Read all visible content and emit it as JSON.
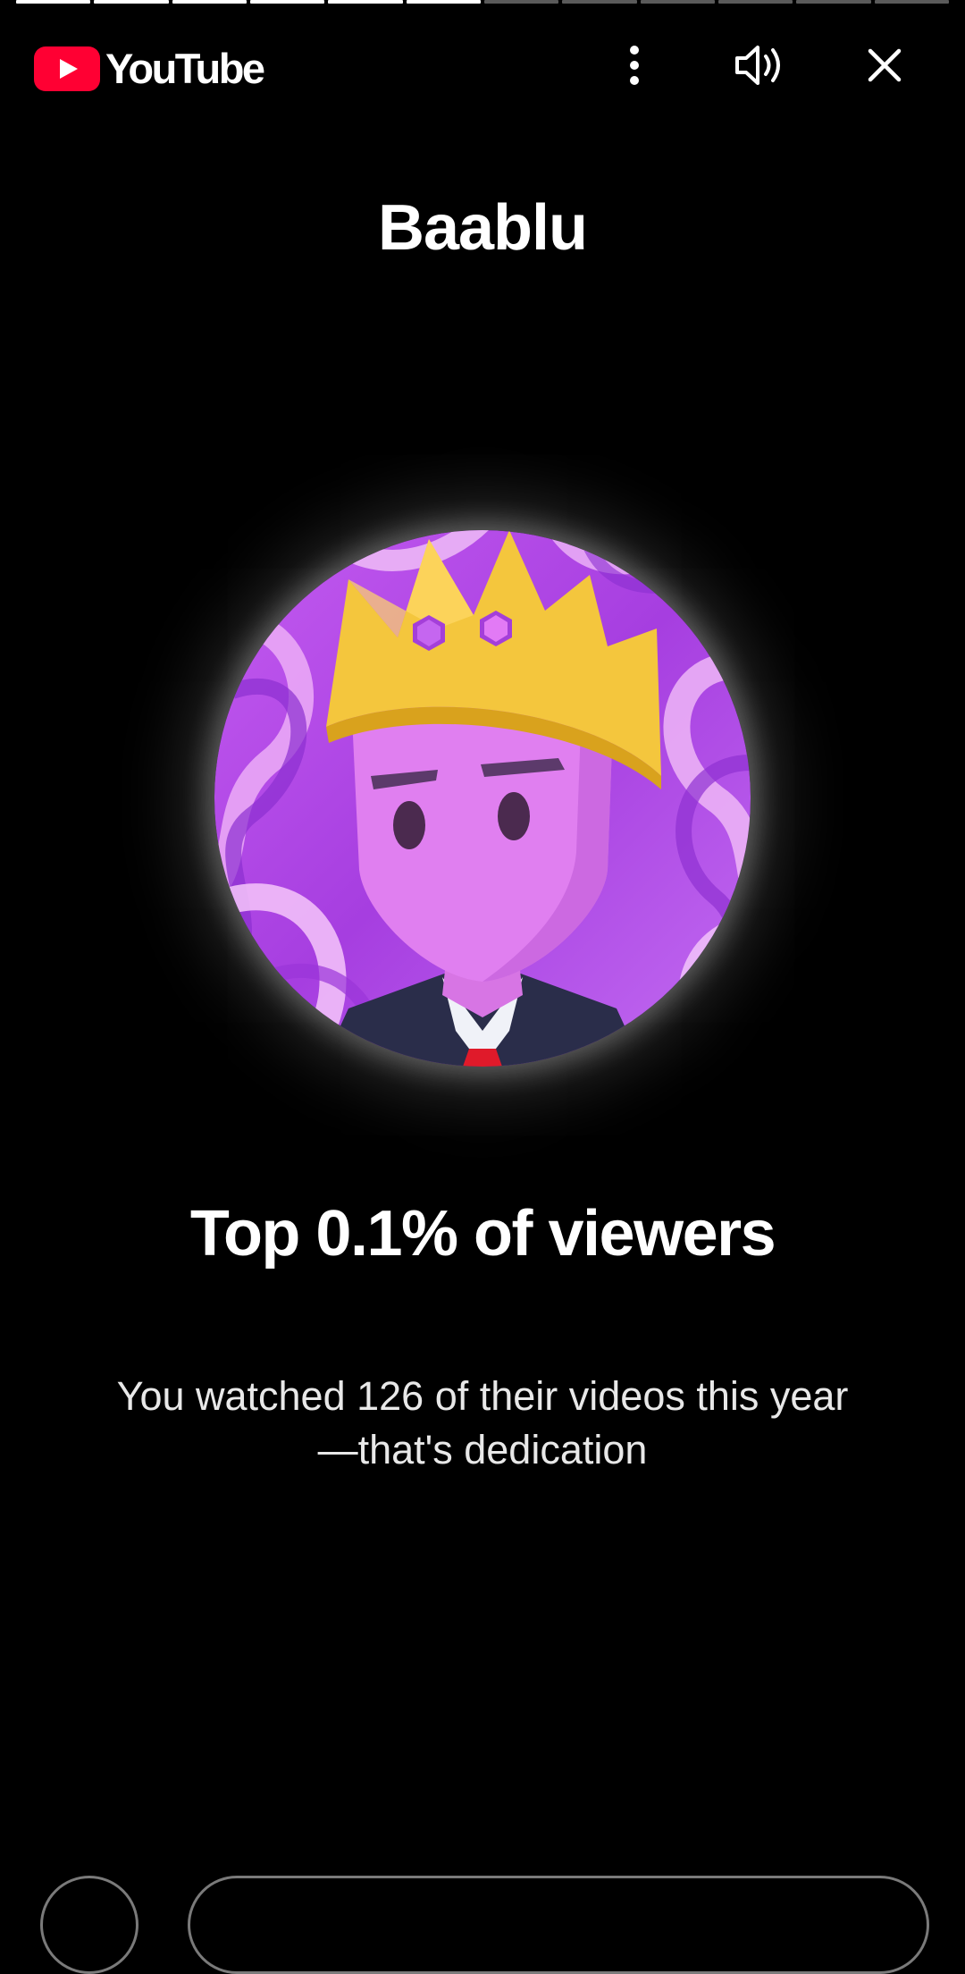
{
  "app": {
    "brand": "YouTube",
    "accent_color": "#FF0033"
  },
  "progress": {
    "segments_total": 12,
    "segments_completed": 6
  },
  "topbar": {
    "icons": [
      "more-vert-icon",
      "volume-icon",
      "close-icon"
    ]
  },
  "story": {
    "channel_name": "Baablu",
    "headline": "Top 0.1% of viewers",
    "subtext": "You watched 126 of their videos this year—that's dedication"
  }
}
